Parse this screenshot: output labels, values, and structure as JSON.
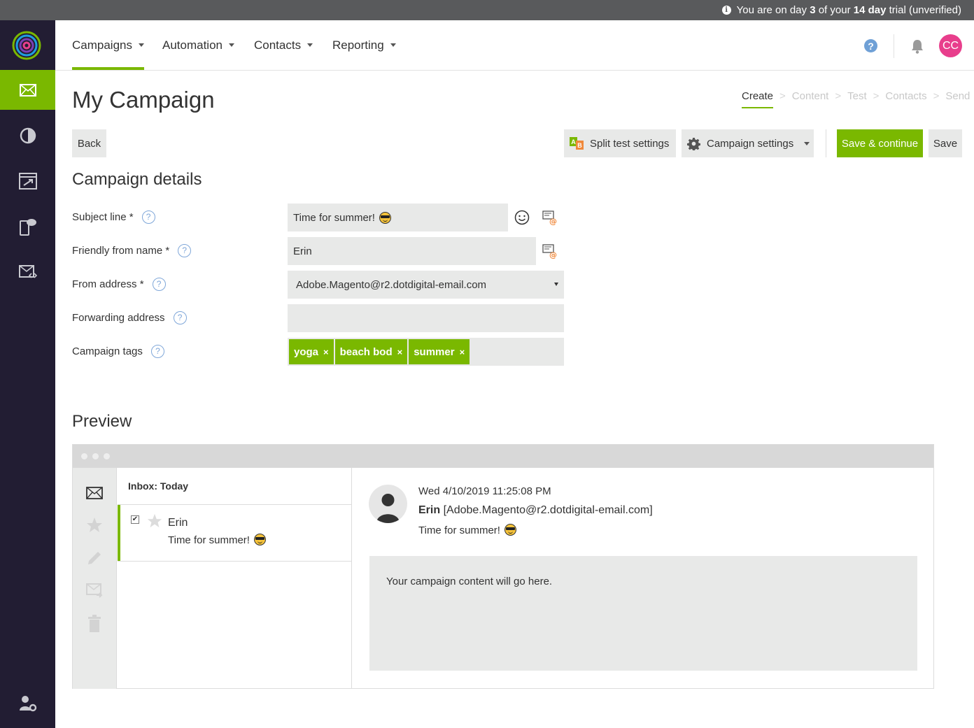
{
  "trial_bar": {
    "prefix": "You are on day ",
    "day": "3",
    "middle": " of your ",
    "length": "14 day",
    "suffix": " trial (unverified)"
  },
  "nav": {
    "items": [
      {
        "label": "Campaigns",
        "active": true
      },
      {
        "label": "Automation"
      },
      {
        "label": "Contacts"
      },
      {
        "label": "Reporting"
      }
    ],
    "help_glyph": "?",
    "avatar_initials": "CC"
  },
  "sidebar": {
    "items": [
      {
        "icon": "mail-icon",
        "active": true
      },
      {
        "icon": "pie-chart-icon"
      },
      {
        "icon": "automation-icon"
      },
      {
        "icon": "mobile-sms-icon"
      },
      {
        "icon": "mail-code-icon"
      },
      {
        "icon": "user-settings-icon"
      }
    ]
  },
  "page": {
    "title": "My Campaign",
    "steps": [
      "Create",
      "Content",
      "Test",
      "Contacts",
      "Send"
    ]
  },
  "toolbar": {
    "back": "Back",
    "split_test": "Split test settings",
    "campaign_settings": "Campaign settings",
    "save_continue": "Save & continue",
    "save": "Save"
  },
  "details": {
    "title": "Campaign details",
    "subject_label": "Subject line *",
    "subject_value": "Time for summer!",
    "from_name_label": "Friendly from name *",
    "from_name_value": "Erin",
    "from_address_label": "From address *",
    "from_address_value": "Adobe.Magento@r2.dotdigital-email.com",
    "forwarding_label": "Forwarding address",
    "forwarding_value": "",
    "tags_label": "Campaign tags",
    "tags": [
      "yoga",
      "beach bod",
      "summer"
    ],
    "tag_remove": "×",
    "help_glyph": "?"
  },
  "preview": {
    "title": "Preview",
    "inbox_header": "Inbox: Today",
    "msg_check": "✔",
    "msg_from": "Erin",
    "msg_subject": "Time for summer!",
    "date": "Wed 4/10/2019 11:25:08 PM",
    "from_name": "Erin",
    "from_address": "[Adobe.Magento@r2.dotdigital-email.com]",
    "subject": "Time for summer!",
    "content_placeholder": "Your campaign content will go here."
  },
  "colors": {
    "accent": "#7ab800",
    "sidebar": "#221d33",
    "avatar": "#e83e8c",
    "field": "#e8e9e8"
  }
}
